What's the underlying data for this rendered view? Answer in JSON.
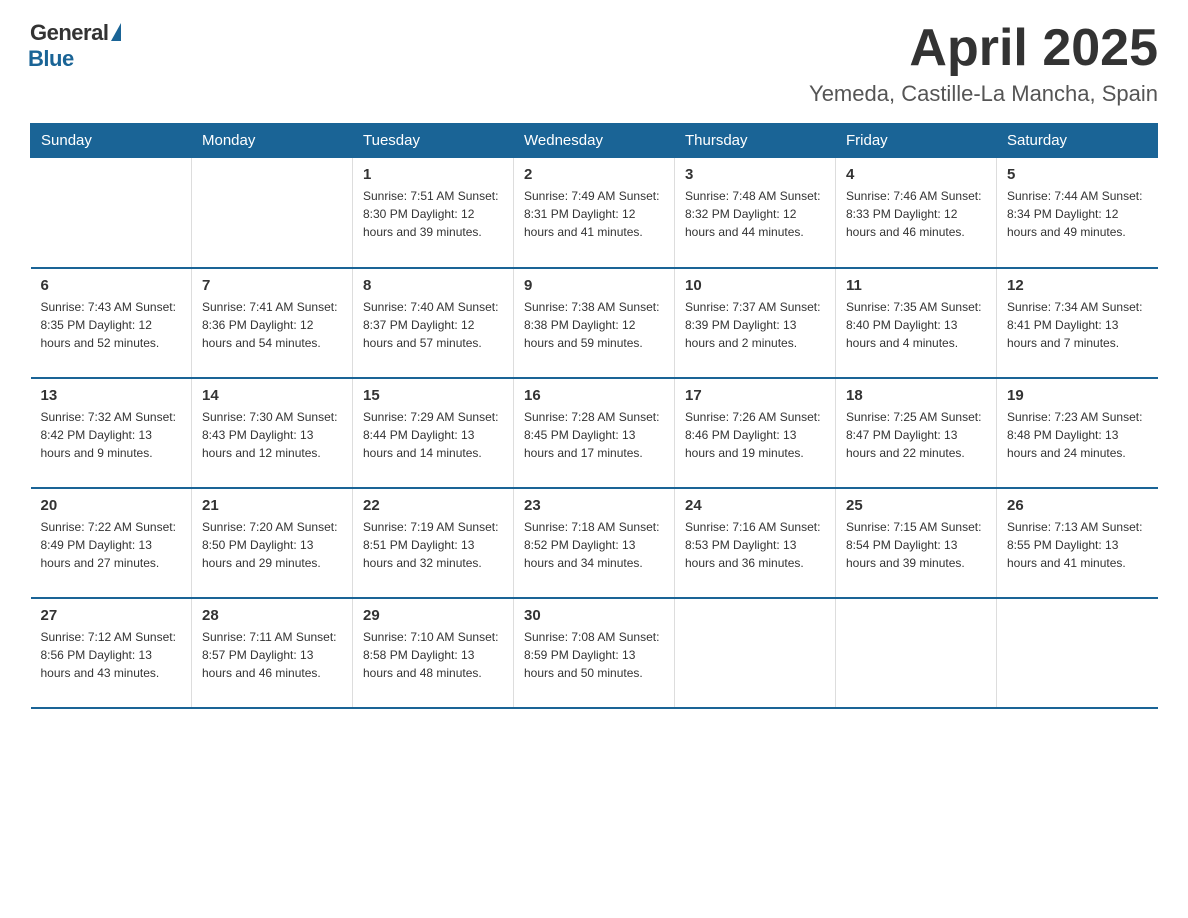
{
  "logo": {
    "general": "General",
    "blue": "Blue"
  },
  "header": {
    "month": "April 2025",
    "location": "Yemeda, Castille-La Mancha, Spain"
  },
  "weekdays": [
    "Sunday",
    "Monday",
    "Tuesday",
    "Wednesday",
    "Thursday",
    "Friday",
    "Saturday"
  ],
  "weeks": [
    [
      {
        "day": "",
        "info": ""
      },
      {
        "day": "",
        "info": ""
      },
      {
        "day": "1",
        "info": "Sunrise: 7:51 AM\nSunset: 8:30 PM\nDaylight: 12 hours\nand 39 minutes."
      },
      {
        "day": "2",
        "info": "Sunrise: 7:49 AM\nSunset: 8:31 PM\nDaylight: 12 hours\nand 41 minutes."
      },
      {
        "day": "3",
        "info": "Sunrise: 7:48 AM\nSunset: 8:32 PM\nDaylight: 12 hours\nand 44 minutes."
      },
      {
        "day": "4",
        "info": "Sunrise: 7:46 AM\nSunset: 8:33 PM\nDaylight: 12 hours\nand 46 minutes."
      },
      {
        "day": "5",
        "info": "Sunrise: 7:44 AM\nSunset: 8:34 PM\nDaylight: 12 hours\nand 49 minutes."
      }
    ],
    [
      {
        "day": "6",
        "info": "Sunrise: 7:43 AM\nSunset: 8:35 PM\nDaylight: 12 hours\nand 52 minutes."
      },
      {
        "day": "7",
        "info": "Sunrise: 7:41 AM\nSunset: 8:36 PM\nDaylight: 12 hours\nand 54 minutes."
      },
      {
        "day": "8",
        "info": "Sunrise: 7:40 AM\nSunset: 8:37 PM\nDaylight: 12 hours\nand 57 minutes."
      },
      {
        "day": "9",
        "info": "Sunrise: 7:38 AM\nSunset: 8:38 PM\nDaylight: 12 hours\nand 59 minutes."
      },
      {
        "day": "10",
        "info": "Sunrise: 7:37 AM\nSunset: 8:39 PM\nDaylight: 13 hours\nand 2 minutes."
      },
      {
        "day": "11",
        "info": "Sunrise: 7:35 AM\nSunset: 8:40 PM\nDaylight: 13 hours\nand 4 minutes."
      },
      {
        "day": "12",
        "info": "Sunrise: 7:34 AM\nSunset: 8:41 PM\nDaylight: 13 hours\nand 7 minutes."
      }
    ],
    [
      {
        "day": "13",
        "info": "Sunrise: 7:32 AM\nSunset: 8:42 PM\nDaylight: 13 hours\nand 9 minutes."
      },
      {
        "day": "14",
        "info": "Sunrise: 7:30 AM\nSunset: 8:43 PM\nDaylight: 13 hours\nand 12 minutes."
      },
      {
        "day": "15",
        "info": "Sunrise: 7:29 AM\nSunset: 8:44 PM\nDaylight: 13 hours\nand 14 minutes."
      },
      {
        "day": "16",
        "info": "Sunrise: 7:28 AM\nSunset: 8:45 PM\nDaylight: 13 hours\nand 17 minutes."
      },
      {
        "day": "17",
        "info": "Sunrise: 7:26 AM\nSunset: 8:46 PM\nDaylight: 13 hours\nand 19 minutes."
      },
      {
        "day": "18",
        "info": "Sunrise: 7:25 AM\nSunset: 8:47 PM\nDaylight: 13 hours\nand 22 minutes."
      },
      {
        "day": "19",
        "info": "Sunrise: 7:23 AM\nSunset: 8:48 PM\nDaylight: 13 hours\nand 24 minutes."
      }
    ],
    [
      {
        "day": "20",
        "info": "Sunrise: 7:22 AM\nSunset: 8:49 PM\nDaylight: 13 hours\nand 27 minutes."
      },
      {
        "day": "21",
        "info": "Sunrise: 7:20 AM\nSunset: 8:50 PM\nDaylight: 13 hours\nand 29 minutes."
      },
      {
        "day": "22",
        "info": "Sunrise: 7:19 AM\nSunset: 8:51 PM\nDaylight: 13 hours\nand 32 minutes."
      },
      {
        "day": "23",
        "info": "Sunrise: 7:18 AM\nSunset: 8:52 PM\nDaylight: 13 hours\nand 34 minutes."
      },
      {
        "day": "24",
        "info": "Sunrise: 7:16 AM\nSunset: 8:53 PM\nDaylight: 13 hours\nand 36 minutes."
      },
      {
        "day": "25",
        "info": "Sunrise: 7:15 AM\nSunset: 8:54 PM\nDaylight: 13 hours\nand 39 minutes."
      },
      {
        "day": "26",
        "info": "Sunrise: 7:13 AM\nSunset: 8:55 PM\nDaylight: 13 hours\nand 41 minutes."
      }
    ],
    [
      {
        "day": "27",
        "info": "Sunrise: 7:12 AM\nSunset: 8:56 PM\nDaylight: 13 hours\nand 43 minutes."
      },
      {
        "day": "28",
        "info": "Sunrise: 7:11 AM\nSunset: 8:57 PM\nDaylight: 13 hours\nand 46 minutes."
      },
      {
        "day": "29",
        "info": "Sunrise: 7:10 AM\nSunset: 8:58 PM\nDaylight: 13 hours\nand 48 minutes."
      },
      {
        "day": "30",
        "info": "Sunrise: 7:08 AM\nSunset: 8:59 PM\nDaylight: 13 hours\nand 50 minutes."
      },
      {
        "day": "",
        "info": ""
      },
      {
        "day": "",
        "info": ""
      },
      {
        "day": "",
        "info": ""
      }
    ]
  ]
}
